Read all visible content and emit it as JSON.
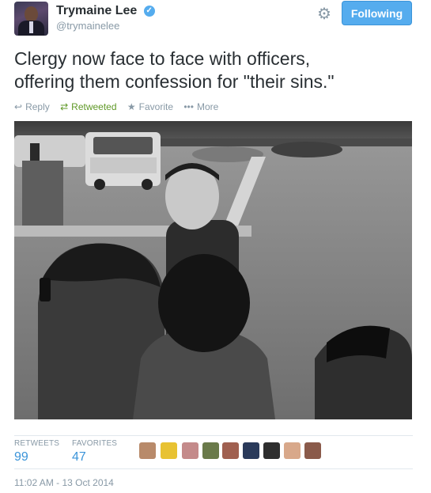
{
  "header": {
    "fullname": "Trymaine Lee",
    "screen_name": "@trymainelee",
    "follow_label": "Following",
    "verified_icon": "verified-icon",
    "settings_icon": "gear-icon"
  },
  "tweet": {
    "text_line1": "Clergy now face to face with officers,",
    "text_line2": "offering them confession for \"their sins.\""
  },
  "actions": {
    "reply_label": "Reply",
    "retweet_label": "Retweeted",
    "favorite_label": "Favorite",
    "more_label": "More"
  },
  "stats": {
    "retweets_label": "RETWEETS",
    "retweets_value": "99",
    "favorites_label": "FAVORITES",
    "favorites_value": "47"
  },
  "timestamp": "11:02 AM - 13 Oct 2014",
  "colors": {
    "accent": "#55acee",
    "retweeted": "#609928",
    "muted": "#8899a6",
    "link": "#3b94d9"
  }
}
